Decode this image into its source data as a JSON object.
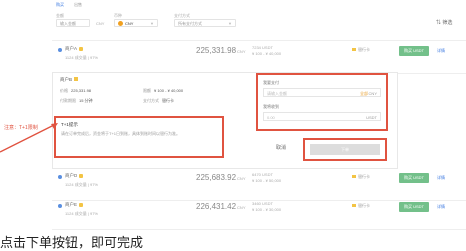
{
  "filter": {
    "tab_buy": "购买",
    "tab_sell": "出售",
    "amount_label": "金额",
    "amount_placeholder": "输入金额",
    "currency_label": "CNY",
    "coin_label": "币种",
    "coin_value": "CNY",
    "pay_label": "支付方式",
    "pay_value": "所有支付方式",
    "filter_button": "筛选"
  },
  "rows": [
    {
      "name": "商户A",
      "sub": "1124 成交量 | 97%",
      "amount": "225,331.98",
      "unit": "CNY",
      "limit_a": "7234 USDT",
      "limit_b": "¥ 100 - ¥ 40,000",
      "pay": "银行卡",
      "buy": "购买 USDT",
      "extra": "详情"
    },
    {
      "name": "商户D",
      "sub": "1124 成交量 | 97%",
      "amount": "225,683.92",
      "unit": "CNY",
      "limit_a": "6470 USDT",
      "limit_b": "¥ 100 - ¥ 50,000",
      "pay": "银行卡",
      "buy": "购买 USDT",
      "extra": "详情"
    },
    {
      "name": "商户E",
      "sub": "1124 成交量 | 97%",
      "amount": "226,431.42",
      "unit": "CNY",
      "limit_a": "3460 USDT",
      "limit_b": "¥ 100 - ¥ 30,000",
      "pay": "银行卡",
      "buy": "购买 USDT",
      "extra": "详情"
    }
  ],
  "panel": {
    "name": "商户B",
    "price_label": "价格",
    "price_value": "225,331.98",
    "limit_label": "限额",
    "limit_value": "¥ 100 - ¥ 40,000",
    "time_label": "付款期限",
    "time_value": "15 分钟",
    "pay_label": "支付方式",
    "pay_value": "银行卡",
    "notice_title": "T+1提示",
    "notice_text": "请在订单完成后，资金将于T+1日到账，具体到账时间以银行为准。"
  },
  "order": {
    "pay_amount_label": "我要支付",
    "pay_amount_placeholder": "请输入金额",
    "all_label": "全部",
    "currency": "CNY",
    "receive_label": "我将收到",
    "receive_placeholder": "0.00",
    "receive_currency": "USDT",
    "cancel": "取消",
    "place_order": "下单"
  },
  "annotation": {
    "callout": "注意：T+1限制"
  },
  "caption": "点击下单按钮，即可完成"
}
